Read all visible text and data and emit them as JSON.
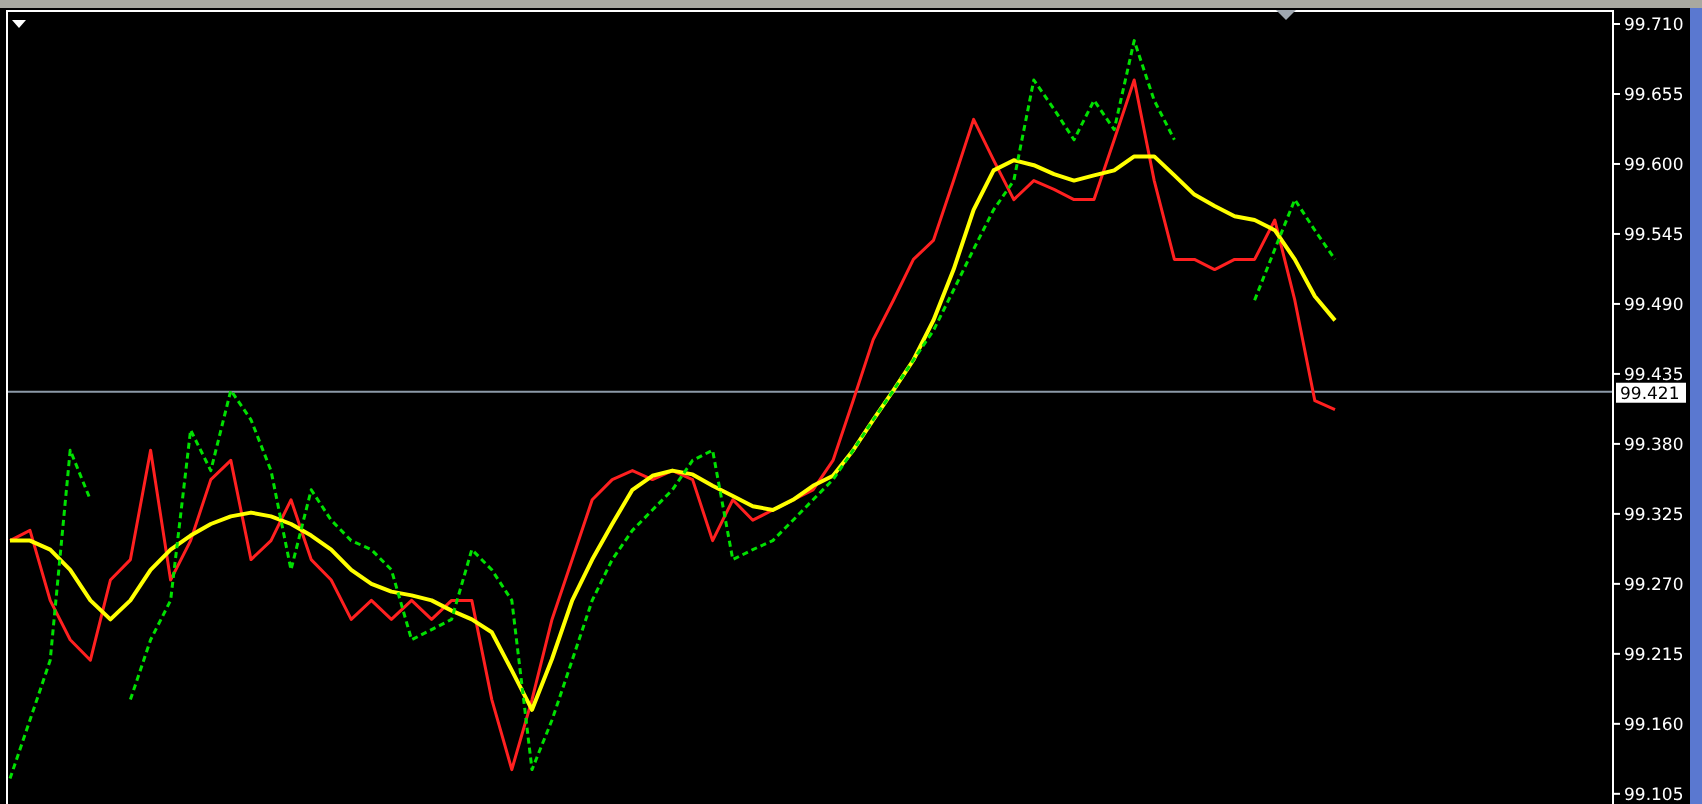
{
  "chart": {
    "chart_data": {
      "type": "line",
      "categories": [
        null,
        null,
        null,
        null,
        null,
        null,
        null,
        null,
        null,
        null,
        null,
        null,
        null,
        null,
        null,
        null,
        null,
        null,
        null,
        null,
        null,
        null,
        null,
        null,
        null,
        null,
        null,
        null,
        null,
        null,
        null,
        null,
        null,
        null,
        null,
        null,
        null,
        null,
        null,
        null,
        null,
        null,
        null,
        null,
        null,
        null,
        null,
        null,
        null,
        null,
        null,
        null,
        null,
        null,
        null,
        null,
        null,
        null,
        null,
        null,
        null,
        null,
        null,
        null,
        null,
        null,
        null
      ],
      "ylim": [
        99.097,
        99.721
      ],
      "yticks": [
        {
          "value": 99.71,
          "label": "99.710"
        },
        {
          "value": 99.655,
          "label": "99.655"
        },
        {
          "value": 99.6,
          "label": "99.600"
        },
        {
          "value": 99.545,
          "label": "99.545"
        },
        {
          "value": 99.49,
          "label": "99.490"
        },
        {
          "value": 99.435,
          "label": "99.435"
        },
        {
          "value": 99.38,
          "label": "99.380"
        },
        {
          "value": 99.325,
          "label": "99.325"
        },
        {
          "value": 99.27,
          "label": "99.270"
        },
        {
          "value": 99.215,
          "label": "99.215"
        },
        {
          "value": 99.16,
          "label": "99.160"
        },
        {
          "value": 99.105,
          "label": "99.105"
        }
      ],
      "series": [
        {
          "color": "#ff2020",
          "values": [
            99.304,
            99.312,
            99.257,
            99.226,
            99.21,
            99.273,
            99.289,
            99.375,
            99.273,
            99.304,
            99.352,
            99.367,
            99.289,
            99.304,
            99.336,
            99.289,
            99.273,
            99.242,
            99.257,
            99.242,
            99.257,
            99.242,
            99.257,
            99.257,
            99.179,
            99.124,
            99.179,
            99.242,
            99.289,
            99.336,
            99.352,
            99.359,
            99.352,
            99.359,
            99.352,
            99.304,
            99.336,
            99.32,
            99.328,
            99.336,
            99.344,
            99.367,
            99.414,
            99.462,
            99.493,
            99.525,
            99.54,
            99.587,
            99.635,
            99.603,
            99.572,
            99.587,
            99.58,
            99.572,
            99.572,
            99.619,
            99.666,
            99.587,
            99.525,
            99.525,
            99.517,
            99.525,
            99.525,
            99.556,
            99.493,
            99.414,
            99.407
          ]
        },
        {
          "color": "#ffff00",
          "values": [
            99.304,
            99.304,
            99.297,
            99.281,
            99.257,
            99.242,
            99.257,
            99.281,
            99.297,
            99.308,
            99.317,
            99.323,
            99.326,
            99.323,
            99.317,
            99.308,
            99.297,
            99.281,
            99.27,
            99.264,
            99.261,
            99.257,
            99.249,
            99.242,
            99.232,
            99.202,
            99.171,
            99.211,
            99.257,
            99.289,
            99.317,
            99.344,
            99.355,
            99.359,
            99.356,
            99.347,
            99.339,
            99.331,
            99.328,
            99.336,
            99.347,
            99.355,
            99.375,
            99.399,
            99.422,
            99.446,
            99.477,
            99.517,
            99.564,
            99.595,
            99.603,
            99.599,
            99.592,
            99.587,
            99.591,
            99.595,
            99.606,
            99.606,
            99.591,
            99.576,
            99.567,
            99.559,
            99.556,
            99.548,
            99.525,
            99.496,
            99.477
          ]
        },
        {
          "color": "#00e000",
          "line_style": "dashed",
          "values": [
            99.117,
            99.163,
            99.21,
            99.375,
            99.336,
            null,
            99.179,
            99.226,
            99.257,
            99.391,
            99.359,
            99.422,
            99.399,
            99.359,
            99.281,
            99.344,
            99.32,
            99.304,
            99.297,
            99.281,
            99.226,
            99.234,
            99.242,
            99.297,
            99.281,
            99.257,
            99.124,
            99.163,
            99.21,
            99.257,
            99.289,
            99.312,
            99.328,
            99.344,
            99.367,
            99.375,
            99.289,
            99.297,
            99.304,
            99.32,
            99.336,
            99.352,
            99.375,
            99.399,
            99.422,
            99.446,
            99.469,
            99.501,
            99.533,
            99.564,
            99.587,
            99.666,
            99.643,
            99.619,
            99.65,
            99.627,
            99.697,
            99.65,
            99.619,
            null,
            null,
            null,
            99.493,
            99.533,
            99.572,
            99.548,
            99.525
          ]
        }
      ],
      "ref_lines": [
        {
          "axis": "y",
          "value": 99.421,
          "color": "#8c9aa8"
        }
      ],
      "annotations": [
        "99.421"
      ]
    }
  }
}
